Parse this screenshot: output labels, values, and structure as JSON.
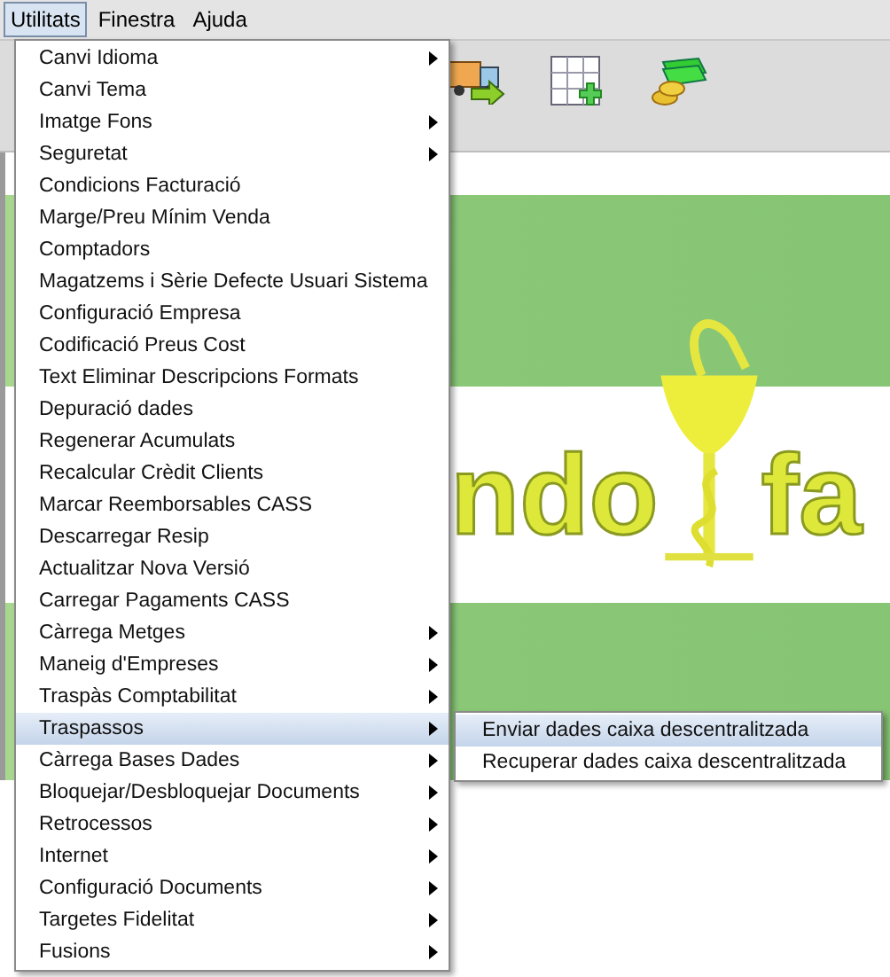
{
  "menubar": [
    {
      "label": "Utilitats",
      "selected": true
    },
    {
      "label": "Finestra",
      "selected": false
    },
    {
      "label": "Ajuda",
      "selected": false
    }
  ],
  "logo": {
    "left": "ndo",
    "right": "fa"
  },
  "menu": {
    "items": [
      {
        "label": "Canvi Idioma",
        "has_submenu": true,
        "selected": false
      },
      {
        "label": "Canvi Tema",
        "has_submenu": false,
        "selected": false
      },
      {
        "label": "Imatge Fons",
        "has_submenu": true,
        "selected": false
      },
      {
        "label": "Seguretat",
        "has_submenu": true,
        "selected": false
      },
      {
        "label": "Condicions Facturació",
        "has_submenu": false,
        "selected": false
      },
      {
        "label": "Marge/Preu Mínim Venda",
        "has_submenu": false,
        "selected": false
      },
      {
        "label": "Comptadors",
        "has_submenu": false,
        "selected": false
      },
      {
        "label": "Magatzems i Sèrie Defecte Usuari Sistema",
        "has_submenu": false,
        "selected": false
      },
      {
        "label": "Configuració Empresa",
        "has_submenu": false,
        "selected": false
      },
      {
        "label": "Codificació Preus Cost",
        "has_submenu": false,
        "selected": false
      },
      {
        "label": "Text Eliminar Descripcions Formats",
        "has_submenu": false,
        "selected": false
      },
      {
        "label": "Depuració dades",
        "has_submenu": false,
        "selected": false
      },
      {
        "label": "Regenerar Acumulats",
        "has_submenu": false,
        "selected": false
      },
      {
        "label": "Recalcular Crèdit Clients",
        "has_submenu": false,
        "selected": false
      },
      {
        "label": "Marcar Reemborsables CASS",
        "has_submenu": false,
        "selected": false
      },
      {
        "label": "Descarregar Resip",
        "has_submenu": false,
        "selected": false
      },
      {
        "label": "Actualitzar Nova Versió",
        "has_submenu": false,
        "selected": false
      },
      {
        "label": "Carregar Pagaments CASS",
        "has_submenu": false,
        "selected": false
      },
      {
        "label": "Càrrega Metges",
        "has_submenu": true,
        "selected": false
      },
      {
        "label": "Maneig d'Empreses",
        "has_submenu": true,
        "selected": false
      },
      {
        "label": "Traspàs Comptabilitat",
        "has_submenu": true,
        "selected": false
      },
      {
        "label": "Traspassos",
        "has_submenu": true,
        "selected": true
      },
      {
        "label": "Càrrega Bases Dades",
        "has_submenu": true,
        "selected": false
      },
      {
        "label": "Bloquejar/Desbloquejar Documents",
        "has_submenu": true,
        "selected": false
      },
      {
        "label": "Retrocessos",
        "has_submenu": true,
        "selected": false
      },
      {
        "label": "Internet",
        "has_submenu": true,
        "selected": false
      },
      {
        "label": "Configuració Documents",
        "has_submenu": true,
        "selected": false
      },
      {
        "label": "Targetes Fidelitat",
        "has_submenu": true,
        "selected": false
      },
      {
        "label": "Fusions",
        "has_submenu": true,
        "selected": false
      }
    ]
  },
  "submenu": {
    "items": [
      {
        "label": "Enviar dades caixa descentralitzada",
        "selected": true
      },
      {
        "label": "Recuperar dades caixa descentralitzada",
        "selected": false
      }
    ]
  }
}
